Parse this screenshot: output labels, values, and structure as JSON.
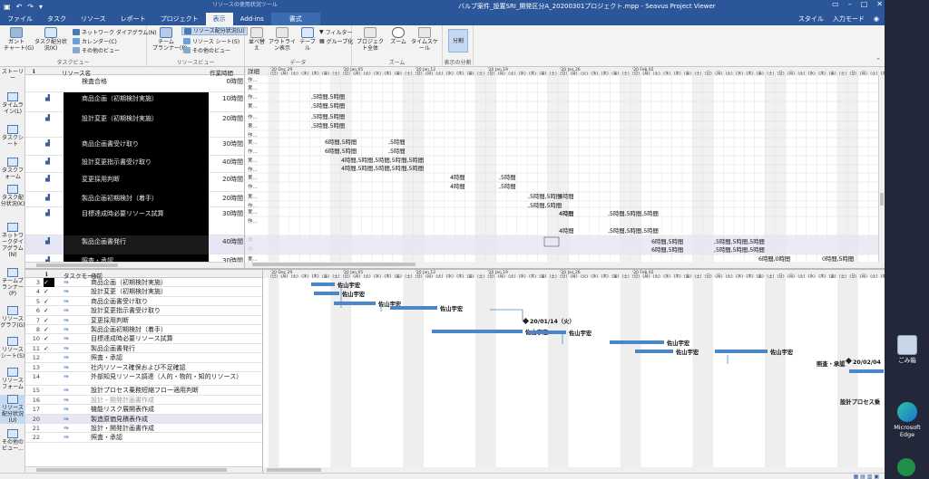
{
  "titlebar": {
    "context_group": "リソースの使用状況ツール",
    "title": "バルブ案件_設置SRI_開発区分A_20200301プロジェクト.mpp - Seavus Project Viewer",
    "qa_icons": [
      "save-icon",
      "undo-icon",
      "redo-icon",
      "customize-icon"
    ]
  },
  "tabs": [
    {
      "label": "ファイル"
    },
    {
      "label": "タスク"
    },
    {
      "label": "リソース"
    },
    {
      "label": "レポート"
    },
    {
      "label": "プロジェクト"
    },
    {
      "label": "表示"
    },
    {
      "label": "Add-ins"
    },
    {
      "label": "書式"
    }
  ],
  "tabs_right": {
    "style": "スタイル",
    "signin": "入力モード"
  },
  "ribbon": {
    "task_views": {
      "label": "タスクビュー",
      "gantt": "ガント\nチャート(G)",
      "task_usage": "タスク配分状況(K)",
      "network": "ネットワーク ダイアグラム(N)",
      "calendar": "カレンダー(C)",
      "other": "その他のビュー"
    },
    "resource_views": {
      "label": "リソースビュー",
      "planner": "チーム\nプランナー(P)",
      "resource_usage": "リソース配分状況(U)",
      "resource_sheet": "リソース シート(S)",
      "other": "その他のビュー"
    },
    "data": {
      "label": "データ",
      "sort": "並べ替え",
      "outline": "アウトライン表示",
      "table": "テーブル",
      "filter": "フィルター",
      "group": "グループ化"
    },
    "zoom": {
      "label": "ズーム",
      "timescale": "タイムスケール",
      "zoom": "ズーム",
      "entire": "プロジェクト全体"
    },
    "split": {
      "label": "表示の分割",
      "split": "分割"
    }
  },
  "viewbar": [
    {
      "label": "ストーリー"
    },
    {
      "label": "タイムライン(L)"
    },
    {
      "label": "タスクシート"
    },
    {
      "label": "タスクフォーム"
    },
    {
      "label": "タスク配分状況(K)"
    },
    {
      "label": "ネットワークダイアグラム(N)"
    },
    {
      "label": "チームプランナー(P)"
    },
    {
      "label": "リソースグラフ(G)"
    },
    {
      "label": "リソースシート(S)"
    },
    {
      "label": "リソースフォーム"
    },
    {
      "label": "リソース配分状況(U)"
    },
    {
      "label": "その他のビュー..."
    }
  ],
  "top_grid": {
    "headers": {
      "info": "ℹ",
      "name": "リソース名",
      "work": "作業時間"
    },
    "rows": [
      {
        "name": "検査合格",
        "work": "0時間"
      },
      {
        "name": "商品企画（初期検討実施）",
        "work": "10時間"
      },
      {
        "name": "設計変更（初期検討実施）",
        "work": "20時間"
      },
      {
        "name": "商品企画書受け取り",
        "work": "30時間"
      },
      {
        "name": "設計変更指示書受け取り",
        "work": "40時間"
      },
      {
        "name": "変更採用判断",
        "work": "20時間"
      },
      {
        "name": "製品企画初期検討（着手）",
        "work": "20時間"
      },
      {
        "name": "目標達成時必要リソース試算",
        "work": "30時間"
      },
      {
        "name": "製品企画書発行",
        "work": "40時間"
      },
      {
        "name": "照査・承認",
        "work": "30時間"
      }
    ]
  },
  "usage": {
    "detail_header": "詳細",
    "detail_labels": [
      "作...",
      "実..."
    ],
    "weeks": [
      "'20 Dec 29",
      "'20 Jan 05",
      "'20 Jan 12",
      "'20 Jan 19",
      "'20 Jan 26",
      "'20 Feb 02"
    ],
    "days": [
      "日",
      "月",
      "火",
      "水",
      "木",
      "金",
      "土"
    ],
    "values": {
      "v5a": ",5時間,5時間",
      "v5b": ",5時間,5時間",
      "v5c": ",5時間,5時間",
      "v5d": ",5時間,5時間",
      "v6a": "6時間,5時間",
      "v6b": "6時間,5時間",
      "v6c": ",5時間",
      "v6d": ",5時間",
      "v4a": "4時間,5時間,5時間,5時間,5時間",
      "v4b": "4時間,5時間,5時間,5時間,5時間",
      "v4c": "4時間",
      "v4d": "4時間",
      "v5e": ",5時間",
      "v5f": ",5時間",
      "v4e": "4時間",
      "v4f": "4時間",
      "v5g": ",5時間,5時間",
      "v5h": ",5時間,5時間",
      "v4g": "4時間",
      "v4h": "4時間",
      "v5i": ",5時間,5時間,5時間",
      "v5j": ",5時間,5時間,5時間",
      "v6e": "6時間,5時間",
      "v6f": "6時間,5時間",
      "v5k": ",5時間,5時間,5時間",
      "v5l": ",5時間,5時間,5時間",
      "v6g": "6時間,0時間",
      "v0a": "0時間,5時間"
    }
  },
  "bottom_grid": {
    "headers": {
      "id": "",
      "info": "ℹ",
      "mode": "タスクモード",
      "name": "名前"
    },
    "rows": [
      {
        "id": "3",
        "check": "✓",
        "name": "商品企画（初期検討実施）"
      },
      {
        "id": "4",
        "check": "✓",
        "name": "設計変更（初期検討実施）"
      },
      {
        "id": "5",
        "check": "✓",
        "name": "商品企画書受け取り"
      },
      {
        "id": "6",
        "check": "✓",
        "name": "設計変更指示書受け取り"
      },
      {
        "id": "7",
        "check": "✓",
        "name": "変更採用判断"
      },
      {
        "id": "8",
        "check": "✓",
        "name": "製品企画初期検討（着手）"
      },
      {
        "id": "10",
        "check": "✓",
        "name": "目標達成時必要リソース試算"
      },
      {
        "id": "11",
        "check": "✓",
        "name": "製品企画書発行"
      },
      {
        "id": "12",
        "check": "",
        "name": "照査・承認"
      },
      {
        "id": "13",
        "check": "",
        "name": "社内リソース確保および不足確認"
      },
      {
        "id": "14",
        "check": "",
        "name": "外部知見リソース調達（人的・物的・知的リソース）"
      },
      {
        "id": "15",
        "check": "",
        "name": "設計プロセス乗務短縮フロー適用判断"
      },
      {
        "id": "16",
        "check": "",
        "name": "設計・開発計画書作成"
      },
      {
        "id": "17",
        "check": "",
        "name": "機能リスク展開表作成"
      },
      {
        "id": "20",
        "check": "",
        "name": "製造原価見積表作成"
      },
      {
        "id": "21",
        "check": "",
        "name": "設計・開発計画書作成"
      },
      {
        "id": "22",
        "check": "",
        "name": "照査・承認"
      }
    ]
  },
  "gantt": {
    "labels": {
      "sakuyama": "佐山宇宏",
      "milestone1": "20/01/14（火）",
      "shosa": "照査・承認",
      "milestone2": "20/02/04",
      "design": "設計プロセス乗"
    }
  },
  "desktop": {
    "recycle": "ごみ箱",
    "edge": "Microsoft Edge"
  },
  "colors": {
    "ribbon_blue": "#2b579a",
    "bar_blue": "#4a86c8"
  }
}
